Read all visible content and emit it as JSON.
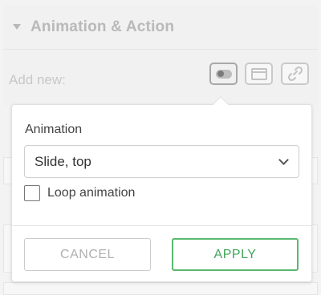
{
  "section": {
    "title": "Animation & Action",
    "add_new_label": "Add new:"
  },
  "add_new_buttons": [
    {
      "name": "toggle-icon",
      "active": true
    },
    {
      "name": "window-icon",
      "active": false
    },
    {
      "name": "link-icon",
      "active": false
    }
  ],
  "popover": {
    "field_label": "Animation",
    "select_value": "Slide, top",
    "checkbox_label": "Loop animation",
    "checkbox_checked": false,
    "cancel_label": "CANCEL",
    "apply_label": "APPLY"
  },
  "colors": {
    "apply_accent": "#58b86f",
    "muted_text": "#b9b9b9"
  }
}
